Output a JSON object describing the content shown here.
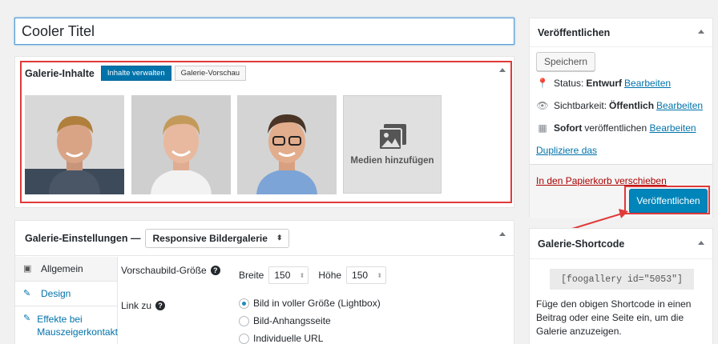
{
  "title": {
    "value": "Cooler Titel"
  },
  "gallery": {
    "heading": "Galerie-Inhalte",
    "tabs": [
      {
        "label": "Inhalte verwalten",
        "active": true
      },
      {
        "label": "Galerie-Vorschau",
        "active": false
      }
    ],
    "add_media_label": "Medien hinzufügen",
    "images": [
      "Porträtfoto 1",
      "Porträtfoto 2",
      "Porträtfoto 3"
    ]
  },
  "settings": {
    "heading": "Galerie-Einstellungen —",
    "template_value": "Responsive Bildergalerie",
    "side_tabs": [
      {
        "label": "Allgemein",
        "icon": "image-icon"
      },
      {
        "label": "Design",
        "icon": "brush-icon"
      },
      {
        "label": "Effekte bei Mauszeigerkontakt",
        "icon": "brush-icon"
      }
    ],
    "thumb_size_label": "Vorschaubild-Größe",
    "width_label": "Breite",
    "width_value": "150",
    "height_label": "Höhe",
    "height_value": "150",
    "link_to_label": "Link zu",
    "link_options": [
      {
        "label": "Bild in voller Größe (Lightbox)",
        "selected": true
      },
      {
        "label": "Bild-Anhangsseite",
        "selected": false
      },
      {
        "label": "Individuelle URL",
        "selected": false
      }
    ]
  },
  "publish": {
    "heading": "Veröffentlichen",
    "save_label": "Speichern",
    "status_label": "Status:",
    "status_value": "Entwurf",
    "visibility_label": "Sichtbarkeit:",
    "visibility_value": "Öffentlich",
    "schedule_bold": "Sofort",
    "schedule_text": "veröffentlichen",
    "edit_link": "Bearbeiten",
    "duplicate_link": "Dupliziere das",
    "trash_link": "In den Papierkorb verschieben",
    "publish_label": "Veröffentlichen"
  },
  "shortcode": {
    "heading": "Galerie-Shortcode",
    "code": "[foogallery id=\"5053\"]",
    "description": "Füge den obigen Shortcode in einen Beitrag oder eine Seite ein, um die Galerie anzuzeigen."
  },
  "colors": {
    "accent": "#0085ba",
    "highlight": "#e03a3a"
  }
}
